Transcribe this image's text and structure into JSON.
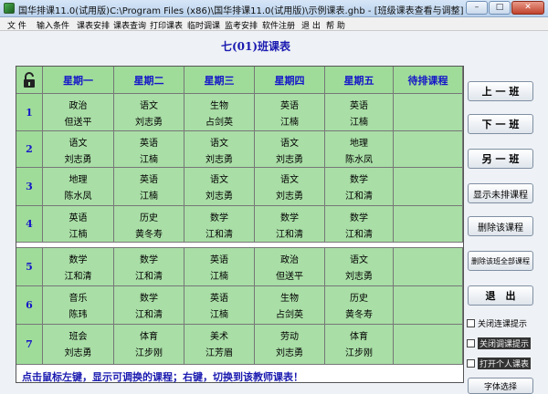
{
  "window": {
    "title": "国华排课11.0(试用版)C:\\Program Files (x86)\\国华排课11.0(试用版)\\示例课表.ghb - [班级课表查看与调整]",
    "min_label": "–",
    "max_label": "□",
    "close_label": "✕"
  },
  "menu": [
    "文 件",
    "输入条件",
    "课表安排",
    "课表查询",
    "打印课表",
    "临时调课",
    "监考安排",
    "软件注册",
    "退 出",
    "帮 助"
  ],
  "page_title": "七(01)班课表",
  "lock_icon": "unlock-icon",
  "days": [
    "星期一",
    "星期二",
    "星期三",
    "星期四",
    "星期五",
    "待排课程"
  ],
  "periods": [
    "1",
    "2",
    "3",
    "4",
    "5",
    "6",
    "7"
  ],
  "schedule": [
    [
      {
        "s": "政治",
        "t": "但送平"
      },
      {
        "s": "语文",
        "t": "刘志勇"
      },
      {
        "s": "生物",
        "t": "占剑英"
      },
      {
        "s": "英语",
        "t": "江楠"
      },
      {
        "s": "英语",
        "t": "江楠"
      },
      {
        "s": "",
        "t": ""
      }
    ],
    [
      {
        "s": "语文",
        "t": "刘志勇"
      },
      {
        "s": "英语",
        "t": "江楠"
      },
      {
        "s": "语文",
        "t": "刘志勇"
      },
      {
        "s": "语文",
        "t": "刘志勇"
      },
      {
        "s": "地理",
        "t": "陈水凤"
      },
      {
        "s": "",
        "t": ""
      }
    ],
    [
      {
        "s": "地理",
        "t": "陈水凤"
      },
      {
        "s": "英语",
        "t": "江楠"
      },
      {
        "s": "语文",
        "t": "刘志勇"
      },
      {
        "s": "语文",
        "t": "刘志勇"
      },
      {
        "s": "数学",
        "t": "江和清"
      },
      {
        "s": "",
        "t": ""
      }
    ],
    [
      {
        "s": "英语",
        "t": "江楠"
      },
      {
        "s": "历史",
        "t": "黄冬寿"
      },
      {
        "s": "数学",
        "t": "江和清"
      },
      {
        "s": "数学",
        "t": "江和清"
      },
      {
        "s": "数学",
        "t": "江和清"
      },
      {
        "s": "",
        "t": ""
      }
    ],
    [
      {
        "s": "数学",
        "t": "江和清"
      },
      {
        "s": "数学",
        "t": "江和清"
      },
      {
        "s": "英语",
        "t": "江楠"
      },
      {
        "s": "政治",
        "t": "但送平"
      },
      {
        "s": "语文",
        "t": "刘志勇"
      },
      {
        "s": "",
        "t": ""
      }
    ],
    [
      {
        "s": "音乐",
        "t": "陈玮"
      },
      {
        "s": "数学",
        "t": "江和清"
      },
      {
        "s": "英语",
        "t": "江楠"
      },
      {
        "s": "生物",
        "t": "占剑英"
      },
      {
        "s": "历史",
        "t": "黄冬寿"
      },
      {
        "s": "",
        "t": ""
      }
    ],
    [
      {
        "s": "班会",
        "t": "刘志勇"
      },
      {
        "s": "体育",
        "t": "江步刚"
      },
      {
        "s": "美术",
        "t": "江芳眉"
      },
      {
        "s": "劳动",
        "t": "刘志勇"
      },
      {
        "s": "体育",
        "t": "江步刚"
      },
      {
        "s": "",
        "t": ""
      }
    ]
  ],
  "side": {
    "prev_class": "上 一 班",
    "next_class": "下 一 班",
    "other_class": "另 一 班",
    "show_unscheduled": "显示未排课程",
    "delete_course": "删除该课程",
    "delete_all": "删除该班全部课程",
    "exit": "退　出",
    "font_select": "字体选择"
  },
  "checkboxes": {
    "close_conflict_hint": "关闭连课提示",
    "close_adjust_hint": "关闭调课提示",
    "open_personal_table": "打开个人课表"
  },
  "hint": "点击鼠标左键，显示可调换的课程；右键，切换到该教师课表！",
  "colors": {
    "header_bg": "#9fdc9a",
    "cell_bg": "#a9dea6",
    "title_blue": "#1a1ab0"
  }
}
